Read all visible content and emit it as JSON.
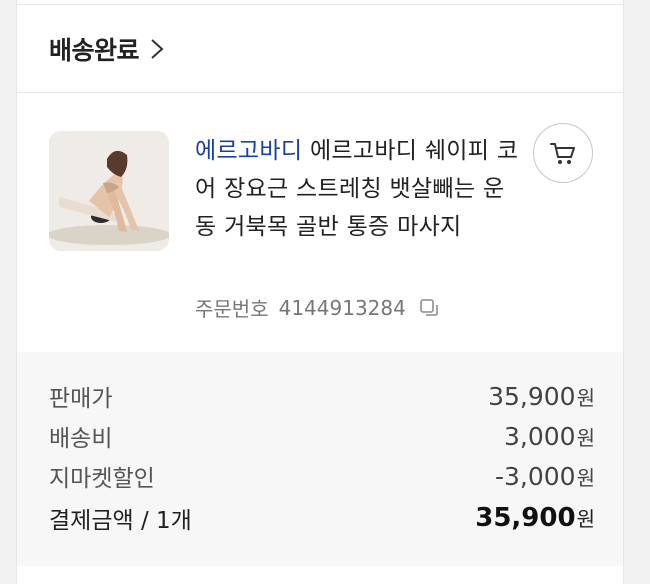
{
  "order": {
    "status_label": "배송완료",
    "product": {
      "brand": "에르고바디",
      "name": "에르고바디 쉐이피 코어 장요근 스트레칭 뱃살빼는 운동 거북목 골반 통증 마사지",
      "order_number_label": "주문번호",
      "order_number": "4144913284"
    },
    "summary": [
      {
        "label": "판매가",
        "value": "35,900",
        "unit": "원"
      },
      {
        "label": "배송비",
        "value": "3,000",
        "unit": "원"
      },
      {
        "label": "지마켓할인",
        "value": "-3,000",
        "unit": "원"
      },
      {
        "label": "결제금액 / 1개",
        "value": "35,900",
        "unit": "원"
      }
    ]
  },
  "icons": {
    "status_chevron": "chevron-right-icon",
    "cart": "cart-icon",
    "copy": "copy-icon"
  }
}
